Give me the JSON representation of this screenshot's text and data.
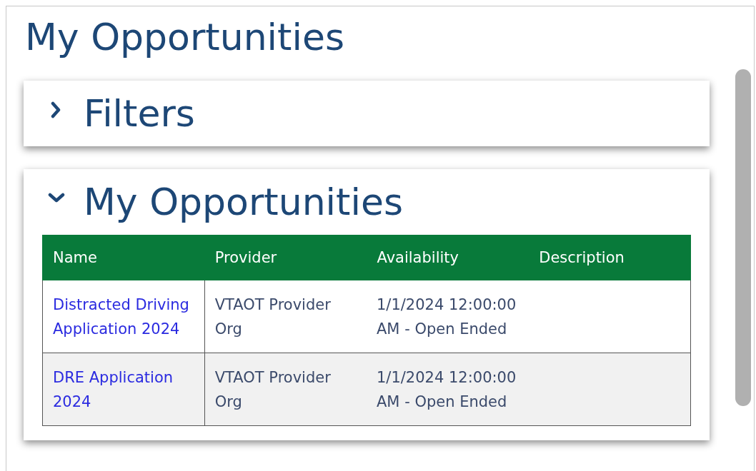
{
  "page_title": "My Opportunities",
  "panels": [
    {
      "title": "Filters",
      "expanded": false
    },
    {
      "title": "My Opportunities",
      "expanded": true,
      "table": {
        "columns": [
          "Name",
          "Provider",
          "Availability",
          "Description"
        ],
        "rows": [
          {
            "name": "Distracted Driving Application 2024",
            "provider": "VTAOT Provider Org",
            "availability": "1/1/2024 12:00:00 AM - Open Ended"
          },
          {
            "name": "DRE Application 2024",
            "provider": "VTAOT Provider Org",
            "availability": "1/1/2024 12:00:00 AM - Open Ended"
          }
        ]
      }
    }
  ]
}
